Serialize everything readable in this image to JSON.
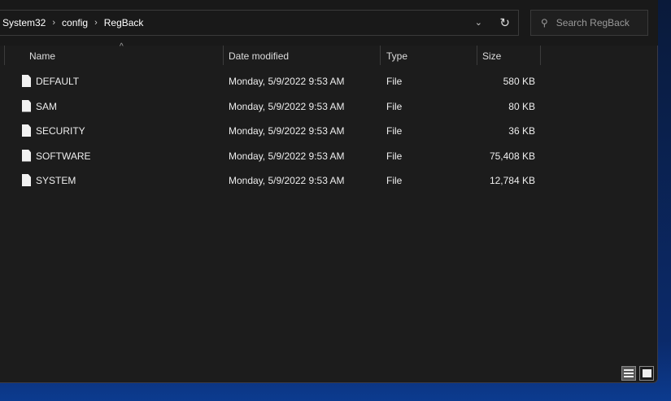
{
  "breadcrumb": [
    "System32",
    "config",
    "RegBack"
  ],
  "search": {
    "placeholder": "Search RegBack"
  },
  "columns": {
    "name": "Name",
    "date": "Date modified",
    "type": "Type",
    "size": "Size"
  },
  "files": [
    {
      "name": "DEFAULT",
      "date": "Monday, 5/9/2022 9:53 AM",
      "type": "File",
      "size": "580 KB"
    },
    {
      "name": "SAM",
      "date": "Monday, 5/9/2022 9:53 AM",
      "type": "File",
      "size": "80 KB"
    },
    {
      "name": "SECURITY",
      "date": "Monday, 5/9/2022 9:53 AM",
      "type": "File",
      "size": "36 KB"
    },
    {
      "name": "SOFTWARE",
      "date": "Monday, 5/9/2022 9:53 AM",
      "type": "File",
      "size": "75,408 KB"
    },
    {
      "name": "SYSTEM",
      "date": "Monday, 5/9/2022 9:53 AM",
      "type": "File",
      "size": "12,784 KB"
    }
  ]
}
